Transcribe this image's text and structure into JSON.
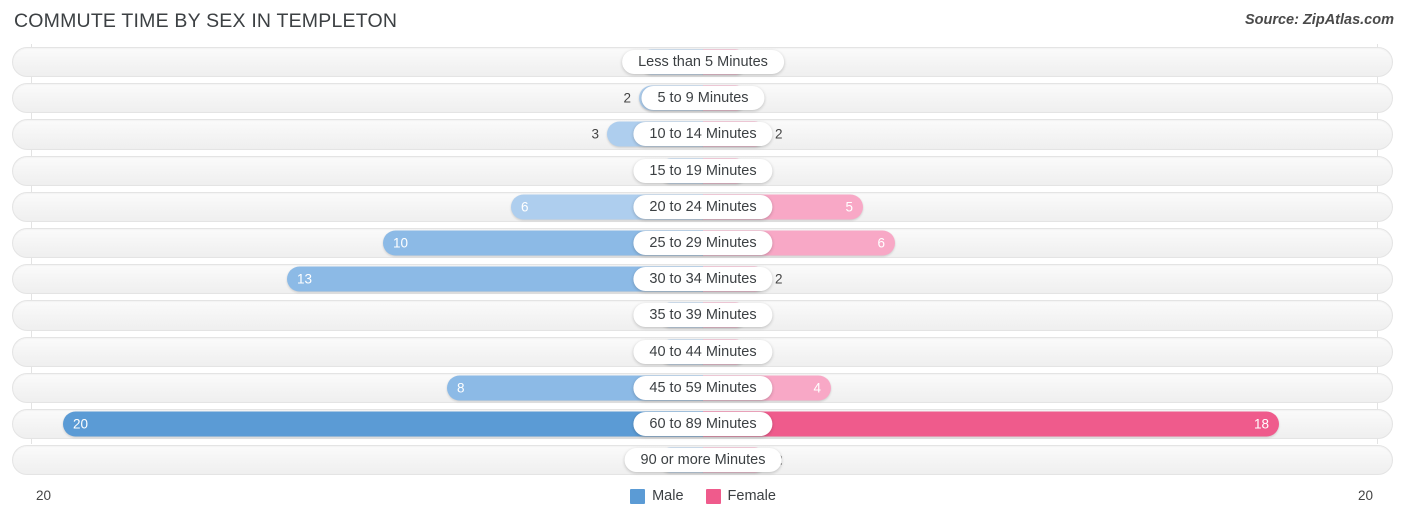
{
  "header": {
    "title": "COMMUTE TIME BY SEX IN TEMPLETON",
    "source": "Source: ZipAtlas.com"
  },
  "legend": {
    "male_label": "Male",
    "female_label": "Female",
    "male_color": "#5b9bd5",
    "female_color": "#ef5b8c"
  },
  "axis": {
    "left_tick": "20",
    "right_tick": "20"
  },
  "colors": {
    "male_light": "#aeceee",
    "male_mid": "#8cbae6",
    "male_dark": "#5b9bd5",
    "female_light": "#f8a8c6",
    "female_mid": "#f589ae",
    "female_dark": "#ef5b8c",
    "track": "#f4f4f4",
    "track_border": "#e4e4e4",
    "gridline": "#e3e3e3"
  },
  "chart_data": {
    "type": "bar",
    "orientation": "horizontal-diverging",
    "title": "COMMUTE TIME BY SEX IN TEMPLETON",
    "xlabel": "",
    "ylabel": "",
    "xlim": [
      20,
      20
    ],
    "grid": true,
    "legend_position": "bottom-center",
    "categories": [
      "Less than 5 Minutes",
      "5 to 9 Minutes",
      "10 to 14 Minutes",
      "15 to 19 Minutes",
      "20 to 24 Minutes",
      "25 to 29 Minutes",
      "30 to 34 Minutes",
      "35 to 39 Minutes",
      "40 to 44 Minutes",
      "45 to 59 Minutes",
      "60 to 89 Minutes",
      "90 or more Minutes"
    ],
    "series": [
      {
        "name": "Male",
        "values": [
          2,
          2,
          3,
          1,
          6,
          10,
          13,
          0,
          0,
          8,
          20,
          0
        ]
      },
      {
        "name": "Female",
        "values": [
          0,
          0,
          2,
          1,
          5,
          6,
          2,
          0,
          0,
          4,
          18,
          2
        ]
      }
    ]
  },
  "rows": [
    {
      "label": "Less than 5 Minutes",
      "male": "2",
      "female": "0"
    },
    {
      "label": "5 to 9 Minutes",
      "male": "2",
      "female": "0"
    },
    {
      "label": "10 to 14 Minutes",
      "male": "3",
      "female": "2"
    },
    {
      "label": "15 to 19 Minutes",
      "male": "1",
      "female": "1"
    },
    {
      "label": "20 to 24 Minutes",
      "male": "6",
      "female": "5"
    },
    {
      "label": "25 to 29 Minutes",
      "male": "10",
      "female": "6"
    },
    {
      "label": "30 to 34 Minutes",
      "male": "13",
      "female": "2"
    },
    {
      "label": "35 to 39 Minutes",
      "male": "0",
      "female": "0"
    },
    {
      "label": "40 to 44 Minutes",
      "male": "0",
      "female": "0"
    },
    {
      "label": "45 to 59 Minutes",
      "male": "8",
      "female": "4"
    },
    {
      "label": "60 to 89 Minutes",
      "male": "20",
      "female": "18"
    },
    {
      "label": "90 or more Minutes",
      "male": "0",
      "female": "2"
    }
  ]
}
